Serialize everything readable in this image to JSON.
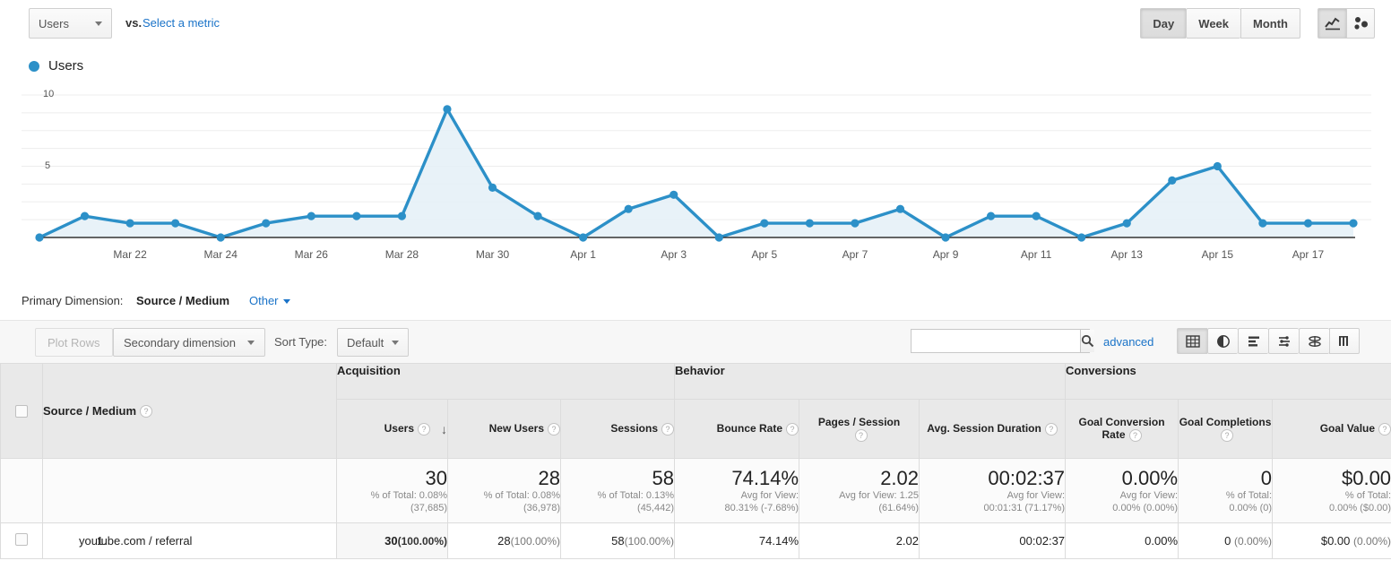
{
  "metric_bar": {
    "metric_button": "Users",
    "vs_label": "vs.",
    "select_metric_link": "Select a metric",
    "granularity": [
      {
        "label": "Day",
        "active": true
      },
      {
        "label": "Week",
        "active": false
      },
      {
        "label": "Month",
        "active": false
      }
    ],
    "chart_types": [
      {
        "name": "line-chart-icon",
        "active": true
      },
      {
        "name": "motion-chart-icon",
        "active": false
      }
    ]
  },
  "legend": {
    "series_label": "Users",
    "series_color": "#2c90c8"
  },
  "chart_data": {
    "type": "area",
    "title": "Users",
    "xlabel": "",
    "ylabel": "Users",
    "ylim": [
      0,
      10
    ],
    "yticks": [
      5,
      10
    ],
    "grid": true,
    "legend": [
      "Users"
    ],
    "legend_position": "top-left",
    "line_color": "#2c90c8",
    "fill_color": "#e4f0f7",
    "leading_tick": "...",
    "xtick_labels": [
      "Mar 22",
      "Mar 24",
      "Mar 26",
      "Mar 28",
      "Mar 30",
      "Apr 1",
      "Apr 3",
      "Apr 5",
      "Apr 7",
      "Apr 9",
      "Apr 11",
      "Apr 13",
      "Apr 15",
      "Apr 17"
    ],
    "x": [
      "Mar 20",
      "Mar 21",
      "Mar 22",
      "Mar 23",
      "Mar 24",
      "Mar 25",
      "Mar 26",
      "Mar 27",
      "Mar 28",
      "Mar 29",
      "Mar 30",
      "Mar 31",
      "Apr 1",
      "Apr 2",
      "Apr 3",
      "Apr 4",
      "Apr 5",
      "Apr 6",
      "Apr 7",
      "Apr 8",
      "Apr 9",
      "Apr 10",
      "Apr 11",
      "Apr 12",
      "Apr 13",
      "Apr 14",
      "Apr 15",
      "Apr 16",
      "Apr 17",
      "Apr 18"
    ],
    "values": [
      0,
      1.5,
      1,
      1,
      0,
      1,
      1.5,
      1.5,
      1.5,
      9,
      3.5,
      1.5,
      0,
      2,
      3,
      0,
      1,
      1,
      1,
      2,
      0,
      1.5,
      1.5,
      0,
      1,
      4,
      5,
      1,
      1,
      1
    ]
  },
  "expander": {
    "name": "chart-expand-handle"
  },
  "primary_dimension": {
    "label": "Primary Dimension:",
    "value": "Source / Medium",
    "other": "Other"
  },
  "toolbar": {
    "plot_rows": "Plot Rows",
    "secondary_dimension": "Secondary dimension",
    "sort_type_label": "Sort Type:",
    "sort_type_value": "Default",
    "search_placeholder": "",
    "search_value": "",
    "advanced": "advanced",
    "view_icons": [
      {
        "name": "table-view-icon",
        "active": true
      },
      {
        "name": "pie-chart-view-icon",
        "active": false
      },
      {
        "name": "bar-chart-view-icon",
        "active": false
      },
      {
        "name": "comparison-view-icon",
        "active": false
      },
      {
        "name": "pivot-view-icon",
        "active": false
      },
      {
        "name": "term-cloud-view-icon",
        "active": false
      }
    ]
  },
  "table": {
    "groups": [
      {
        "label": "Acquisition"
      },
      {
        "label": "Behavior"
      },
      {
        "label": "Conversions"
      }
    ],
    "dimension_header": "Source / Medium",
    "columns": [
      {
        "label": "Users",
        "sorted": true,
        "sort_dir": "desc"
      },
      {
        "label": "New Users"
      },
      {
        "label": "Sessions"
      },
      {
        "label": "Bounce Rate"
      },
      {
        "label": "Pages / Session"
      },
      {
        "label": "Avg. Session Duration"
      },
      {
        "label": "Goal Conversion Rate"
      },
      {
        "label": "Goal Completions"
      },
      {
        "label": "Goal Value"
      }
    ],
    "summary": [
      {
        "big": "30",
        "sub1": "% of Total: 0.08%",
        "sub2": "(37,685)"
      },
      {
        "big": "28",
        "sub1": "% of Total: 0.08%",
        "sub2": "(36,978)"
      },
      {
        "big": "58",
        "sub1": "% of Total: 0.13%",
        "sub2": "(45,442)"
      },
      {
        "big": "74.14%",
        "sub1": "Avg for View:",
        "sub2": "80.31% (-7.68%)"
      },
      {
        "big": "2.02",
        "sub1": "Avg for View: 1.25",
        "sub2": "(61.64%)"
      },
      {
        "big": "00:02:37",
        "sub1": "Avg for View:",
        "sub2": "00:01:31 (71.17%)"
      },
      {
        "big": "0.00%",
        "sub1": "Avg for View:",
        "sub2": "0.00% (0.00%)"
      },
      {
        "big": "0",
        "sub1": "% of Total:",
        "sub2": "0.00% (0)"
      },
      {
        "big": "$0.00",
        "sub1": "% of Total:",
        "sub2": "0.00% ($0.00)"
      }
    ],
    "rows": [
      {
        "index": "1.",
        "dimension": "youtube.com / referral",
        "users": "30",
        "users_pct": "(100.00%)",
        "new_users": "28",
        "new_users_pct": "(100.00%)",
        "sessions": "58",
        "sessions_pct": "(100.00%)",
        "bounce_rate": "74.14%",
        "pages_session": "2.02",
        "avg_duration": "00:02:37",
        "goal_conv_rate": "0.00%",
        "goal_completions": "0",
        "goal_completions_pct": "(0.00%)",
        "goal_value": "$0.00",
        "goal_value_pct": "(0.00%)"
      }
    ]
  }
}
